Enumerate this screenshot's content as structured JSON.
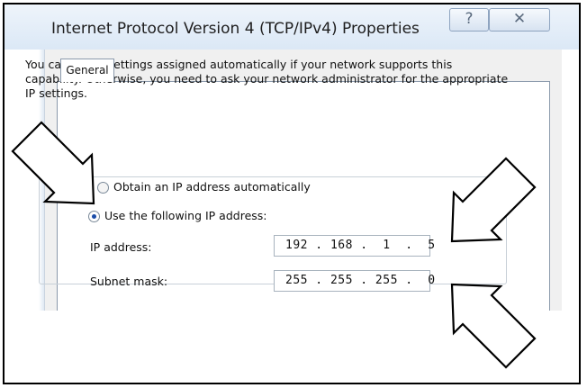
{
  "window": {
    "title": "Internet Protocol Version 4 (TCP/IPv4) Properties",
    "help_glyph": "?",
    "close_glyph": "✕"
  },
  "tabs": [
    {
      "label": "General",
      "selected": true
    }
  ],
  "description": "You can get IP settings assigned automatically if your network supports this capability. Otherwise, you need to ask your network administrator for the appropriate IP settings.",
  "options": {
    "auto": {
      "label": "Obtain an IP address automatically",
      "selected": false
    },
    "manual": {
      "label": "Use the following IP address:",
      "selected": true
    }
  },
  "fields": {
    "ip": {
      "label": "IP address:",
      "value": "192 . 168 .  1  .  5"
    },
    "subnet": {
      "label": "Subnet mask:",
      "value": "255 . 255 . 255 .  0"
    }
  },
  "annotation": {
    "arrow_color": "#000000",
    "arrow_fill": "#ffffff"
  }
}
